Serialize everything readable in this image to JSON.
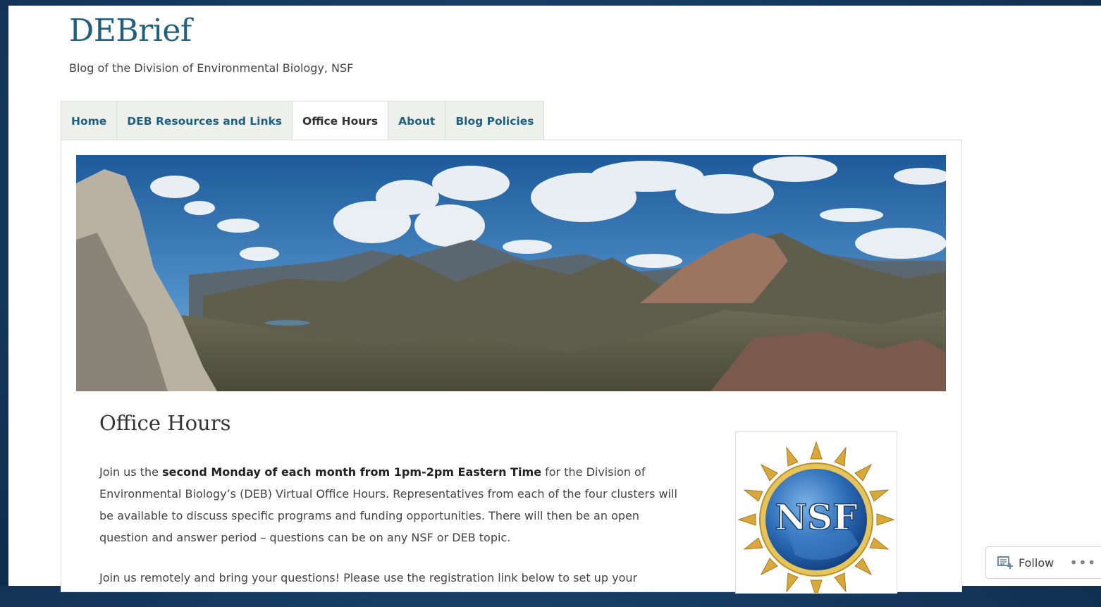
{
  "site": {
    "title": "DEBrief",
    "description": "Blog of the Division of Environmental Biology, NSF"
  },
  "nav": {
    "items": [
      "Home",
      "DEB Resources and Links",
      "Office Hours",
      "About",
      "Blog Policies"
    ],
    "active": "Office Hours"
  },
  "header_image": {
    "alt": "mountain-panorama"
  },
  "page": {
    "title": "Office Hours",
    "p1_prefix": "Join us the ",
    "p1_bold": "second Monday of each month from 1pm-2pm Eastern Time",
    "p1_rest": " for the Division of Environmental Biology’s (DEB) Virtual Office Hours. Representatives from each of the four clusters will be available to discuss specific programs and funding opportunities. There will then be an open question and answer period – questions can be on any NSF or DEB topic.",
    "p2": "Join us remotely and bring your questions! Please use the registration link below to set up your"
  },
  "sidebar": {
    "logo_text": "NSF"
  },
  "follow": {
    "label": "Follow",
    "more": "•••"
  },
  "colors": {
    "link": "#1f5f7f",
    "background": "#163a60",
    "nav_bg": "#eef0ec"
  }
}
